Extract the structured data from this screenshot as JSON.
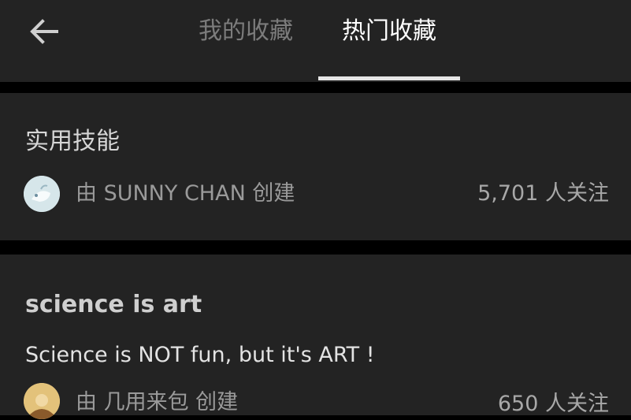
{
  "header": {
    "tabs": [
      {
        "label": "我的收藏",
        "active": false
      },
      {
        "label": "热门收藏",
        "active": true
      }
    ],
    "back_icon": "arrow-left-icon"
  },
  "collections": [
    {
      "title": "实用技能",
      "description": "",
      "creator": "由 SUNNY CHAN 创建",
      "followers": "5,701 人关注"
    },
    {
      "title": "science is art",
      "description": "Science is NOT fun, but it's ART !",
      "creator": "由 几用来包 创建",
      "followers": "650 人关注"
    }
  ],
  "colors": {
    "background": "#000000",
    "surface": "#232323",
    "tab_active": "#ffffff",
    "tab_inactive": "#7c7c7c",
    "indicator": "#e6e6e6"
  }
}
